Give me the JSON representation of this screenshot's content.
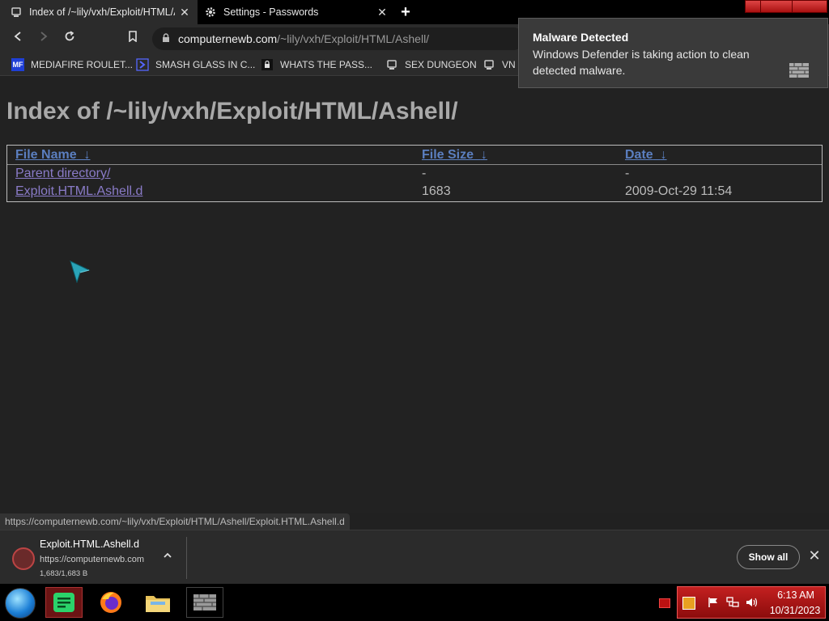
{
  "browser": {
    "tabs": [
      {
        "title": "Index of /~lily/vxh/Exploit/HTML/Ashell/",
        "close": "✕"
      },
      {
        "title": "Settings - Passwords",
        "close": "✕"
      }
    ],
    "new_tab": "+",
    "url_host": "computernewb.com",
    "url_path": "/~lily/vxh/Exploit/HTML/Ashell/",
    "bookmarks": [
      {
        "label": "MEDIAFIRE ROULET...",
        "icon": "MF"
      },
      {
        "label": "SMASH GLASS IN C...",
        "icon": "chevron-icon"
      },
      {
        "label": "WHATS THE PASS...",
        "icon": "lock-icon"
      },
      {
        "label": "SEX DUNGEON",
        "icon": "computernewb-icon"
      },
      {
        "label": "VN",
        "icon": "computernewb-icon"
      }
    ]
  },
  "page": {
    "heading": "Index of /~lily/vxh/Exploit/HTML/Ashell/",
    "columns": {
      "name": "File Name",
      "size": "File Size",
      "date": "Date",
      "sort_glyph": "↓"
    },
    "rows": [
      {
        "name": "Parent directory/",
        "size": "-",
        "date": "-"
      },
      {
        "name": "Exploit.HTML.Ashell.d",
        "size": "1683",
        "date": "2009-Oct-29 11:54"
      }
    ]
  },
  "status_url": "https://computernewb.com/~lily/vxh/Exploit/HTML/Ashell/Exploit.HTML.Ashell.d",
  "download": {
    "filename": "Exploit.HTML.Ashell.d",
    "source": "https://computernewb.com",
    "progress": "1,683/1,683 B",
    "show_all": "Show all",
    "close": "✕"
  },
  "toast": {
    "title": "Malware Detected",
    "body": "Windows Defender is taking action to clean detected malware."
  },
  "taskbar": {
    "time": "6:13 AM",
    "date": "10/31/2023",
    "apps": [
      "notes-app-icon",
      "firefox-icon",
      "file-explorer-icon",
      "windows-defender-icon"
    ]
  },
  "colors": {
    "accent_link": "#5b7fc0",
    "visited_link": "#8a7bc8",
    "tray_red": "#c32020"
  }
}
